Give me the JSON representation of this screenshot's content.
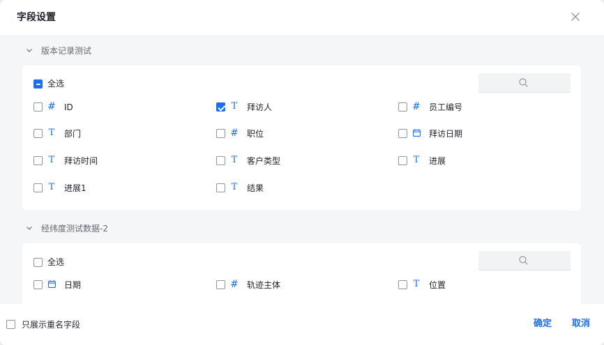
{
  "dialog": {
    "title": "字段设置"
  },
  "sections": [
    {
      "title": "版本记录测试",
      "select_all": {
        "label": "全选",
        "state": "indeterminate"
      },
      "fields": [
        {
          "name": "ID",
          "type": "number",
          "checked": false
        },
        {
          "name": "拜访人",
          "type": "text",
          "checked": true
        },
        {
          "name": "员工编号",
          "type": "number",
          "checked": false
        },
        {
          "name": "部门",
          "type": "text",
          "checked": false
        },
        {
          "name": "职位",
          "type": "number",
          "checked": false
        },
        {
          "name": "拜访日期",
          "type": "date",
          "checked": false
        },
        {
          "name": "拜访时间",
          "type": "text",
          "checked": false
        },
        {
          "name": "客户类型",
          "type": "text",
          "checked": false
        },
        {
          "name": "进展",
          "type": "text",
          "checked": false
        },
        {
          "name": "进展1",
          "type": "text",
          "checked": false
        },
        {
          "name": "结果",
          "type": "text",
          "checked": false
        }
      ]
    },
    {
      "title": "经纬度测试数据-2",
      "select_all": {
        "label": "全选",
        "state": "unchecked"
      },
      "fields": [
        {
          "name": "日期",
          "type": "date",
          "checked": false
        },
        {
          "name": "轨迹主体",
          "type": "number",
          "checked": false
        },
        {
          "name": "位置",
          "type": "text",
          "checked": false
        }
      ]
    }
  ],
  "footer": {
    "show_duplicates_label": "只展示重名字段",
    "show_duplicates_checked": false,
    "confirm_label": "确定",
    "cancel_label": "取消"
  },
  "colors": {
    "accent": "#1a6ef0",
    "text": "#1f2329",
    "muted": "#646a73",
    "body_bg": "#f5f6f7"
  }
}
